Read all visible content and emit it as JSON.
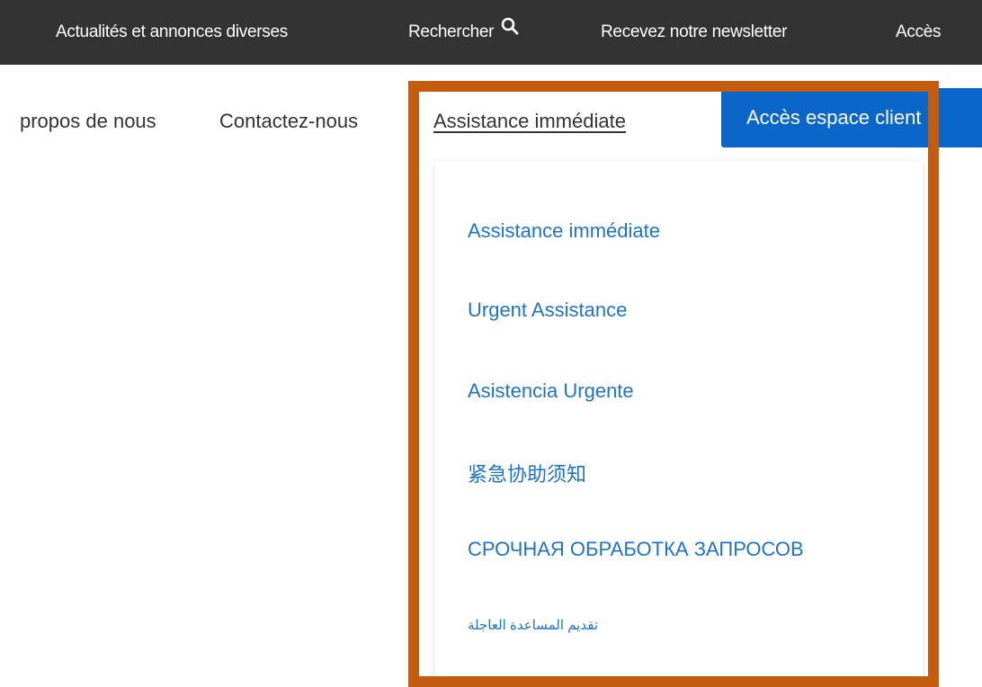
{
  "topbar": {
    "items": [
      {
        "label": "Actualités et annonces diverses"
      },
      {
        "label": "Rechercher"
      },
      {
        "label": "Recevez notre newsletter"
      },
      {
        "label": "Accès"
      }
    ]
  },
  "nav": {
    "about_label": "propos de nous",
    "contact_label": "Contactez-nous",
    "assistance_label": "Assistance immédiate",
    "client_button_label": "Accès espace client"
  },
  "dropdown": {
    "items": [
      {
        "label": "Assistance immédiate"
      },
      {
        "label": "Urgent Assistance"
      },
      {
        "label": "Asistencia Urgente"
      },
      {
        "label": "紧急协助须知"
      },
      {
        "label": "СРОЧНАЯ ОБРАБОТКА ЗАПРОСОВ"
      },
      {
        "label": "تقديم المساعدة العاجلة"
      }
    ]
  },
  "icons": {
    "search": "search-icon"
  },
  "colors": {
    "topbar_bg": "#333333",
    "link_blue": "#1f73c8",
    "button_blue": "#0a67c9",
    "highlight": "#c45c10"
  }
}
